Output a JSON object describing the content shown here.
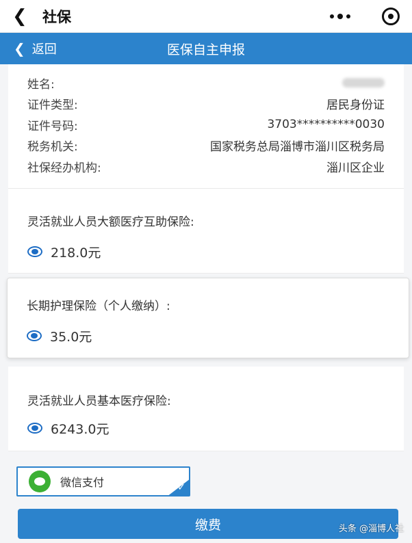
{
  "app_bar": {
    "back_icon": "chevron-left-icon",
    "title": "社保",
    "more_icon": "more-dots-icon",
    "target_icon": "target-icon"
  },
  "header": {
    "back_label": "返回",
    "title": "医保自主申报",
    "color": "#2c83cc"
  },
  "person_info": {
    "name_label": "姓名:",
    "name_value": "",
    "id_type_label": "证件类型:",
    "id_type_value": "居民身份证",
    "id_number_label": "证件号码:",
    "id_number_value": "3703**********0030",
    "tax_office_label": "税务机关:",
    "tax_office_value": "国家税务总局淄博市淄川区税务局",
    "agency_label": "社保经办机构:",
    "agency_value": "淄川区企业"
  },
  "insurances": [
    {
      "label": "灵活就业人员大额医疗互助保险:",
      "amount": "218.0元",
      "selected": true
    },
    {
      "label": "长期护理保险（个人缴纳）:",
      "amount": "35.0元",
      "selected": true
    },
    {
      "label": "灵活就业人员基本医疗保险:",
      "amount": "6243.0元",
      "selected": true
    }
  ],
  "payment": {
    "method_label": "微信支付",
    "method_icon": "wechat-pay-icon",
    "selected": true
  },
  "pay_button": {
    "label": "缴费"
  },
  "watermark": "头条 @淄博人社"
}
